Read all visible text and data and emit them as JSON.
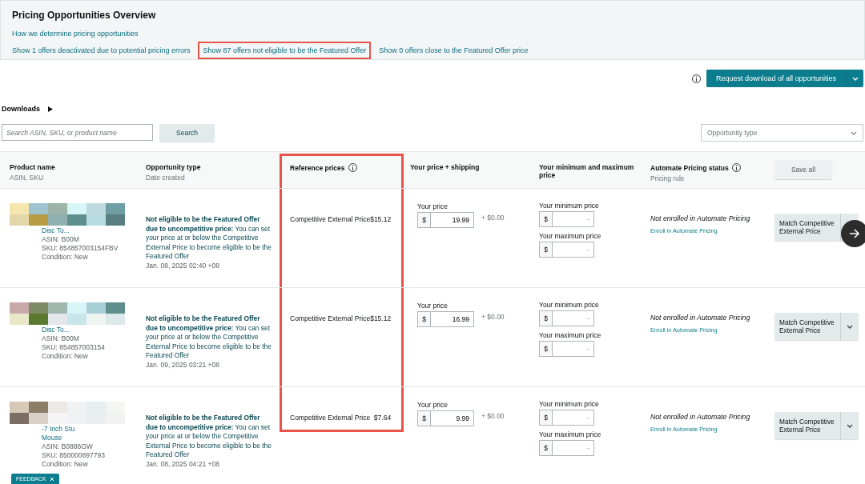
{
  "overview": {
    "title": "Pricing Opportunities Overview",
    "help_link": "How we determine pricing opportunities",
    "filters": [
      {
        "label": "Show 1 offers deactivated due to potential pricing errors",
        "highlighted": false
      },
      {
        "label": "Show 87 offers not eligible to be the Featured Offer",
        "highlighted": true
      },
      {
        "label": "Show 0 offers close to the Featured Offer price",
        "highlighted": false
      }
    ]
  },
  "download_button": "Request download of all opportunities",
  "downloads": {
    "label": "Downloads",
    "expanded": false
  },
  "search": {
    "placeholder": "Search ASIN, SKU, or product name",
    "button": "Search"
  },
  "type_filter": {
    "placeholder": "Opportunity type"
  },
  "table": {
    "columns": [
      {
        "title": "Product name",
        "subtitle": "ASIN, SKU",
        "info": false,
        "highlighted": false
      },
      {
        "title": "Opportunity type",
        "subtitle": "Date created",
        "info": false,
        "highlighted": false
      },
      {
        "title": "Reference prices",
        "info": true,
        "highlighted": true
      },
      {
        "title": "Your price + shipping",
        "info": false,
        "highlighted": false
      },
      {
        "title": "Your minimum and maximum price",
        "info": false,
        "highlighted": false
      },
      {
        "title": "Automate Pricing status",
        "subtitle": "Pricing rule",
        "info": true,
        "highlighted": false
      }
    ],
    "save_all": "Save all",
    "rows": [
      {
        "title_lines": [
          "Disc To..."
        ],
        "asin": "ASIN: B00M",
        "sku": "SKU: 854857003154FBV",
        "condition": "Condition: New",
        "opportunity": "**Not eligible to be the Featured Offer due to uncompetitive price:** You can set your price at or below the Competitive External Price to become eligible to be the Featured Offer",
        "date": "Jan. 08, 2025 02:40 +08",
        "reference": "Competitive External Price$15.12",
        "price_label": "Your price",
        "currency": "$",
        "price": "19.99",
        "shipping": "+ $0.00",
        "min_label": "Your minimum price",
        "max_label": "Your maximum price",
        "min_placeholder": "-",
        "max_placeholder": "-",
        "status": "Not enrolled in Automate Pricing",
        "enroll": "Enroll in Automate Pricing",
        "action": "Match Competitive External Price",
        "next_arrow": true
      },
      {
        "title_lines": [
          "Disc To..."
        ],
        "asin": "ASIN: B00M",
        "sku": "SKU: 854857003154",
        "condition": "Condition: New",
        "opportunity": "**Not eligible to be the Featured Offer due to uncompetitive price:** You can set your price at or below the Competitive External Price to become eligible to be the Featured Offer",
        "date": "Jan. 09, 2025 03:21 +08",
        "reference": "Competitive External Price$15.12",
        "price_label": "Your price",
        "currency": "$",
        "price": "16.99",
        "shipping": "+ $0.00",
        "min_label": "Your minimum price",
        "max_label": "Your maximum price",
        "min_placeholder": "-",
        "max_placeholder": "-",
        "status": "Not enrolled in Automate Pricing",
        "enroll": "Enroll in Automate Pricing",
        "action": "Match Competitive External Price",
        "next_arrow": false
      },
      {
        "title_lines": [
          "-7 Inch Stu",
          "Mouse"
        ],
        "asin": "ASIN: B0886GW",
        "sku": "SKU: 850000897793",
        "condition": "Condition: New",
        "opportunity": "**Not eligible to be the Featured Offer due to uncompetitive price:** You can set your price at or below the Competitive External Price to become eligible to be the Featured Offer",
        "date": "Jan. 08, 2025 04:21 +08",
        "reference": "Competitive External Price  $7.64",
        "price_label": "Your price",
        "currency": "$",
        "price": "9.99",
        "shipping": "+ $0.00",
        "min_label": "Your minimum price",
        "max_label": "Your maximum price",
        "min_placeholder": "-",
        "max_placeholder": "-",
        "status": "Not enrolled in Automate Pricing",
        "enroll": "Enroll in Automate Pricing",
        "action": "Match Competitive External Price",
        "next_arrow": false
      }
    ]
  },
  "feedback": "FEEDBACK"
}
